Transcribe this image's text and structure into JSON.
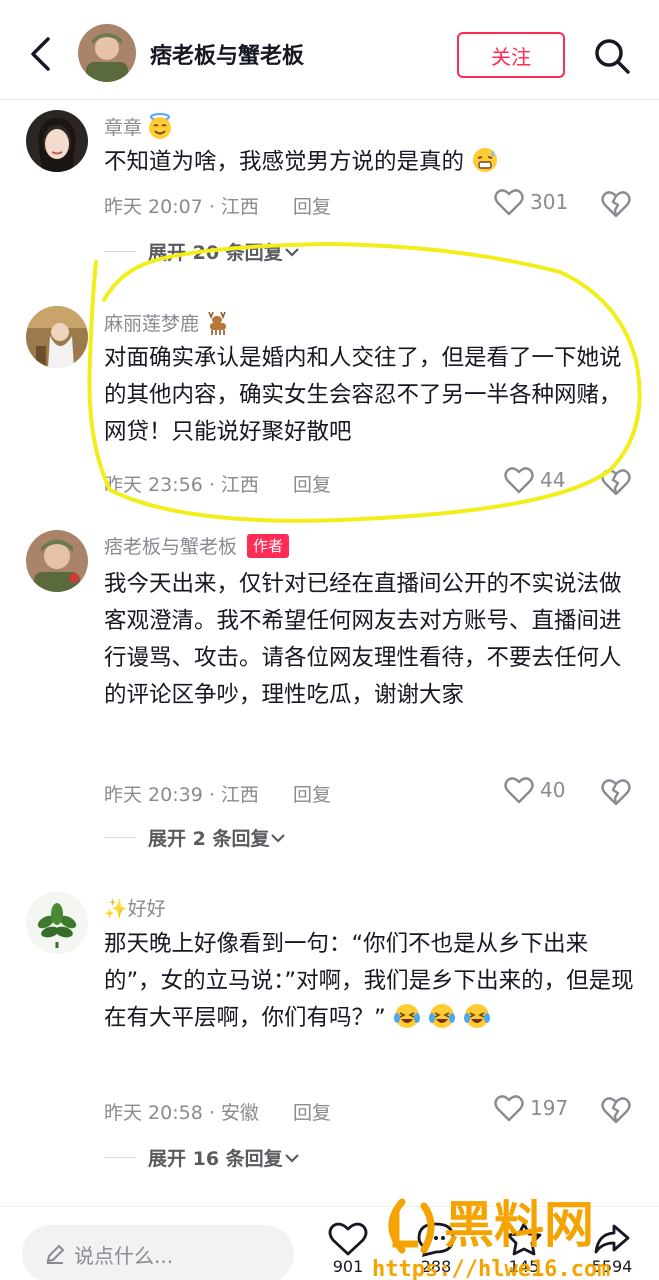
{
  "header": {
    "title": "痞老板与蟹老板",
    "follow_label": "关注"
  },
  "comments": [
    {
      "username": "章章",
      "text": "不知道为啥，我感觉男方说的是真的",
      "time_location": "昨天 20:07 · 江西",
      "reply_label": "回复",
      "likes": "301",
      "expand_label": "展开 20 条回复"
    },
    {
      "username": "麻丽莲梦鹿",
      "text": "对面确实承认是婚内和人交往了，但是看了一下她说的其他内容，确实女生会容忍不了另一半各种网赌，网贷！只能说好聚好散吧",
      "time_location": "昨天 23:56 · 江西",
      "reply_label": "回复",
      "likes": "44"
    },
    {
      "username": "痞老板与蟹老板",
      "author_badge": "作者",
      "text": "我今天出来，仅针对已经在直播间公开的不实说法做客观澄清。我不希望任何网友去对方账号、直播间进行谩骂、攻击。请各位网友理性看待，不要去任何人的评论区争吵，理性吃瓜，谢谢大家",
      "time_location": "昨天 20:39 · 江西",
      "reply_label": "回复",
      "likes": "40",
      "expand_label": "展开 2 条回复"
    },
    {
      "username": "✨好好",
      "text": "那天晚上好像看到一句：“你们不也是从乡下出来的”，女的立马说：”对啊，我们是乡下出来的，但是现在有大平层啊，你们有吗？”",
      "time_location": "昨天 20:58 · 安徽",
      "reply_label": "回复",
      "likes": "197",
      "expand_label": "展开 16 条回复"
    }
  ],
  "bottom_bar": {
    "input_placeholder": "说点什么...",
    "likes": "901",
    "comments": "288",
    "favorites": "145",
    "shares": "5594"
  },
  "watermark": {
    "brand": "黑料网",
    "url": "https://hlwe16.com"
  },
  "colors": {
    "accent": "#fe2c55",
    "annotation": "#f2ee1a",
    "watermark": "#f5a300"
  }
}
